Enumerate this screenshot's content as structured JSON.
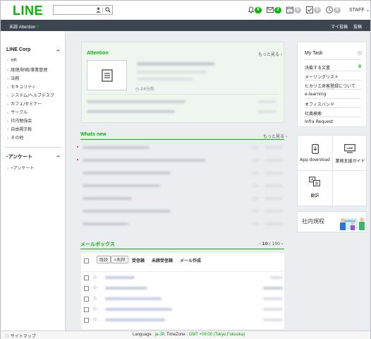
{
  "header": {
    "logo": "LINE",
    "notifications": {
      "bell": "6",
      "mail": "2",
      "calendar": "0",
      "todo": "0",
      "clock": "0"
    },
    "user": "STAFF"
  },
  "topbar": {
    "unread_label": "未読 Attention",
    "unread_count": "0",
    "my_posts": "マイ投稿",
    "post": "投稿"
  },
  "sidebar": {
    "group1_title": "LINE Corp",
    "items": [
      "HR",
      "経理/財務/事業管理",
      "法務",
      "セキュリティ",
      "システム/ヘルプデスク",
      "カフェ/セミナー",
      "サークル",
      "社内勉強会",
      "自由掲示板",
      "その他"
    ],
    "group2_title": "アンケート",
    "group2_items": [
      "アンケート"
    ]
  },
  "attention": {
    "title": "Attention",
    "more": "もっと見る ›",
    "time": "24分前"
  },
  "whats_new": {
    "title": "Whats new",
    "more": "もっと見る ›"
  },
  "mailbox": {
    "title": "メールボックス",
    "page": "10",
    "total": "100",
    "read_btn": "既読",
    "delete_btn": "削除",
    "received": "受信箱",
    "unread_received": "未読受信箱",
    "compose": "メール作成"
  },
  "my_task": {
    "title": "My Task",
    "items": [
      {
        "label": "決裁する文書",
        "count": "0"
      },
      {
        "label": "メーリングリスト"
      },
      {
        "label": "ヒカリエ来客登録について"
      },
      {
        "label": "e-learning"
      },
      {
        "label": "オフィスバンド"
      },
      {
        "label": "社員検索"
      },
      {
        "label": "Infra Request"
      }
    ]
  },
  "apps": {
    "app_download": "App download",
    "support_guide": "業務支援ガイド",
    "translate": "翻訳"
  },
  "kitei": {
    "label": "社内規程"
  },
  "footer": {
    "sitemap": "サイトマップ",
    "language_label": "Language :",
    "language": "ja-JP",
    "timezone_label": ", TimeZone :",
    "timezone": "GMT +09:00 (Tokyo,Fukuoka)"
  },
  "colors": {
    "brand": "#00b900",
    "topbar": "#3d4550"
  }
}
